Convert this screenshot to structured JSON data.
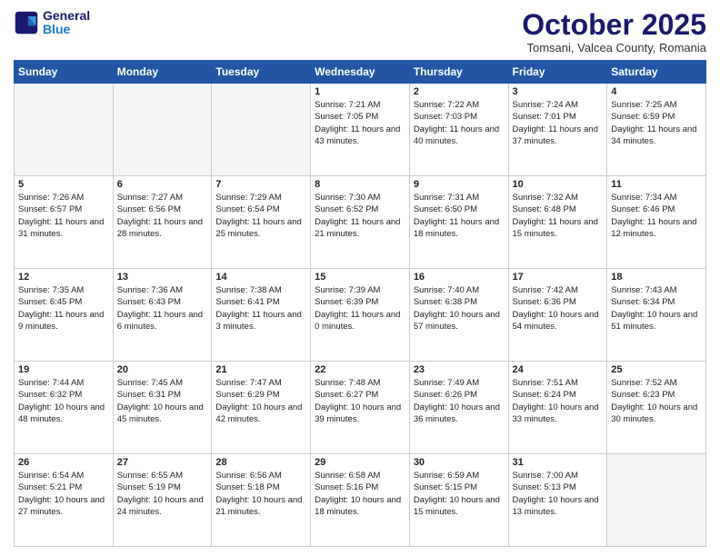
{
  "header": {
    "logo_line1": "General",
    "logo_line2": "Blue",
    "month": "October 2025",
    "location": "Tomsani, Valcea County, Romania"
  },
  "days_of_week": [
    "Sunday",
    "Monday",
    "Tuesday",
    "Wednesday",
    "Thursday",
    "Friday",
    "Saturday"
  ],
  "weeks": [
    [
      {
        "day": "",
        "info": ""
      },
      {
        "day": "",
        "info": ""
      },
      {
        "day": "",
        "info": ""
      },
      {
        "day": "1",
        "info": "Sunrise: 7:21 AM\nSunset: 7:05 PM\nDaylight: 11 hours and 43 minutes."
      },
      {
        "day": "2",
        "info": "Sunrise: 7:22 AM\nSunset: 7:03 PM\nDaylight: 11 hours and 40 minutes."
      },
      {
        "day": "3",
        "info": "Sunrise: 7:24 AM\nSunset: 7:01 PM\nDaylight: 11 hours and 37 minutes."
      },
      {
        "day": "4",
        "info": "Sunrise: 7:25 AM\nSunset: 6:59 PM\nDaylight: 11 hours and 34 minutes."
      }
    ],
    [
      {
        "day": "5",
        "info": "Sunrise: 7:26 AM\nSunset: 6:57 PM\nDaylight: 11 hours and 31 minutes."
      },
      {
        "day": "6",
        "info": "Sunrise: 7:27 AM\nSunset: 6:56 PM\nDaylight: 11 hours and 28 minutes."
      },
      {
        "day": "7",
        "info": "Sunrise: 7:29 AM\nSunset: 6:54 PM\nDaylight: 11 hours and 25 minutes."
      },
      {
        "day": "8",
        "info": "Sunrise: 7:30 AM\nSunset: 6:52 PM\nDaylight: 11 hours and 21 minutes."
      },
      {
        "day": "9",
        "info": "Sunrise: 7:31 AM\nSunset: 6:50 PM\nDaylight: 11 hours and 18 minutes."
      },
      {
        "day": "10",
        "info": "Sunrise: 7:32 AM\nSunset: 6:48 PM\nDaylight: 11 hours and 15 minutes."
      },
      {
        "day": "11",
        "info": "Sunrise: 7:34 AM\nSunset: 6:46 PM\nDaylight: 11 hours and 12 minutes."
      }
    ],
    [
      {
        "day": "12",
        "info": "Sunrise: 7:35 AM\nSunset: 6:45 PM\nDaylight: 11 hours and 9 minutes."
      },
      {
        "day": "13",
        "info": "Sunrise: 7:36 AM\nSunset: 6:43 PM\nDaylight: 11 hours and 6 minutes."
      },
      {
        "day": "14",
        "info": "Sunrise: 7:38 AM\nSunset: 6:41 PM\nDaylight: 11 hours and 3 minutes."
      },
      {
        "day": "15",
        "info": "Sunrise: 7:39 AM\nSunset: 6:39 PM\nDaylight: 11 hours and 0 minutes."
      },
      {
        "day": "16",
        "info": "Sunrise: 7:40 AM\nSunset: 6:38 PM\nDaylight: 10 hours and 57 minutes."
      },
      {
        "day": "17",
        "info": "Sunrise: 7:42 AM\nSunset: 6:36 PM\nDaylight: 10 hours and 54 minutes."
      },
      {
        "day": "18",
        "info": "Sunrise: 7:43 AM\nSunset: 6:34 PM\nDaylight: 10 hours and 51 minutes."
      }
    ],
    [
      {
        "day": "19",
        "info": "Sunrise: 7:44 AM\nSunset: 6:32 PM\nDaylight: 10 hours and 48 minutes."
      },
      {
        "day": "20",
        "info": "Sunrise: 7:45 AM\nSunset: 6:31 PM\nDaylight: 10 hours and 45 minutes."
      },
      {
        "day": "21",
        "info": "Sunrise: 7:47 AM\nSunset: 6:29 PM\nDaylight: 10 hours and 42 minutes."
      },
      {
        "day": "22",
        "info": "Sunrise: 7:48 AM\nSunset: 6:27 PM\nDaylight: 10 hours and 39 minutes."
      },
      {
        "day": "23",
        "info": "Sunrise: 7:49 AM\nSunset: 6:26 PM\nDaylight: 10 hours and 36 minutes."
      },
      {
        "day": "24",
        "info": "Sunrise: 7:51 AM\nSunset: 6:24 PM\nDaylight: 10 hours and 33 minutes."
      },
      {
        "day": "25",
        "info": "Sunrise: 7:52 AM\nSunset: 6:23 PM\nDaylight: 10 hours and 30 minutes."
      }
    ],
    [
      {
        "day": "26",
        "info": "Sunrise: 6:54 AM\nSunset: 5:21 PM\nDaylight: 10 hours and 27 minutes."
      },
      {
        "day": "27",
        "info": "Sunrise: 6:55 AM\nSunset: 5:19 PM\nDaylight: 10 hours and 24 minutes."
      },
      {
        "day": "28",
        "info": "Sunrise: 6:56 AM\nSunset: 5:18 PM\nDaylight: 10 hours and 21 minutes."
      },
      {
        "day": "29",
        "info": "Sunrise: 6:58 AM\nSunset: 5:16 PM\nDaylight: 10 hours and 18 minutes."
      },
      {
        "day": "30",
        "info": "Sunrise: 6:59 AM\nSunset: 5:15 PM\nDaylight: 10 hours and 15 minutes."
      },
      {
        "day": "31",
        "info": "Sunrise: 7:00 AM\nSunset: 5:13 PM\nDaylight: 10 hours and 13 minutes."
      },
      {
        "day": "",
        "info": ""
      }
    ]
  ]
}
